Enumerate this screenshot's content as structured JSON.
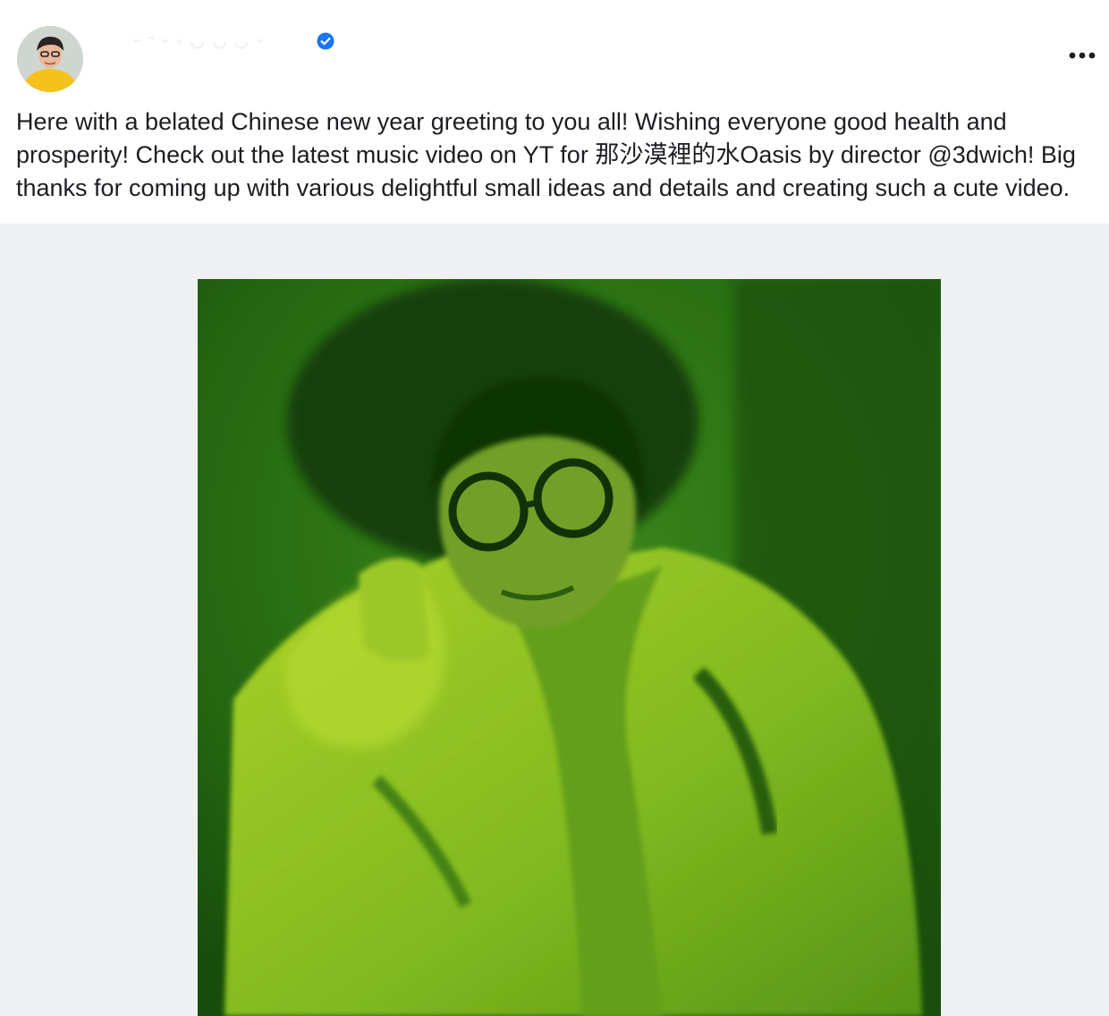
{
  "post": {
    "author_name": "ᵕ ᵔ ᵕ ◦ ◡ ◡ ◡ ᵕ",
    "caption_lines": [
      "Here with a belated Chinese new year greeting to you all! Wishing everyone good health and",
      "prosperity! Check out the latest music video on YT for 那沙漠裡的水Oasis by director @3dwich! Big",
      "thanks for coming up with various delightful small ideas and details and creating such a cute video."
    ],
    "verified_icon": "verified-badge-icon",
    "more_icon": "more-options-icon",
    "colors": {
      "verified_blue": "#1877f2",
      "text": "#1c1e21",
      "photo_tint": "#2f7a16"
    }
  }
}
